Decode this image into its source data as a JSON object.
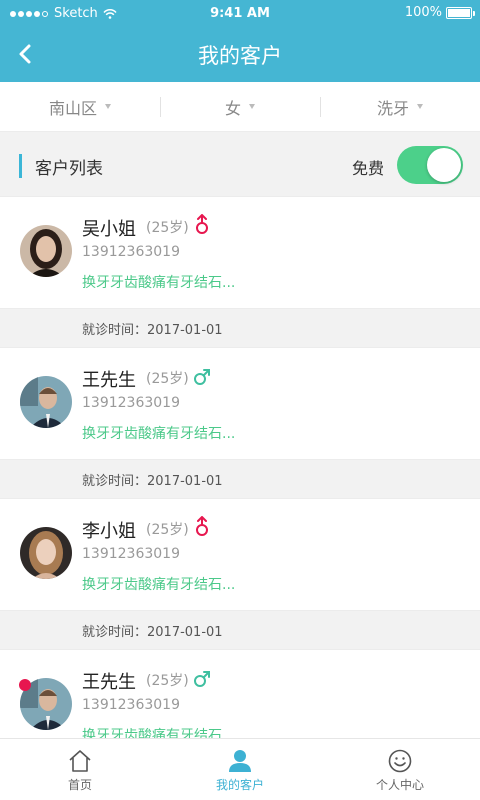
{
  "status_bar": {
    "carrier": "Sketch",
    "time": "9:41 AM",
    "battery": "100%"
  },
  "header": {
    "title": "我的客户",
    "back_icon": "chevron-left-icon"
  },
  "filters": [
    {
      "label": "南山区"
    },
    {
      "label": "女"
    },
    {
      "label": "洗牙"
    }
  ],
  "section": {
    "title": "客户列表",
    "toggle_label": "免费",
    "toggle_on": true
  },
  "customers": [
    {
      "name": "吴小姐",
      "age": "(25岁)",
      "gender": "female",
      "phone": "13912363019",
      "desc": "换牙牙齿酸痛有牙结石...",
      "visit": "就诊时间：2017-01-01"
    },
    {
      "name": "王先生",
      "age": "(25岁)",
      "gender": "male",
      "phone": "13912363019",
      "desc": "换牙牙齿酸痛有牙结石...",
      "visit": "就诊时间：2017-01-01"
    },
    {
      "name": "李小姐",
      "age": "(25岁)",
      "gender": "female",
      "phone": "13912363019",
      "desc": "换牙牙齿酸痛有牙结石...",
      "visit": "就诊时间：2017-01-01"
    },
    {
      "name": "王先生",
      "age": "(25岁)",
      "gender": "male",
      "phone": "13912363019",
      "desc": "换牙牙齿酸痛有牙结石..."
    }
  ],
  "tabs": [
    {
      "label": "首页",
      "icon": "home-icon"
    },
    {
      "label": "我的客户",
      "icon": "user-icon"
    },
    {
      "label": "个人中心",
      "icon": "smiley-icon"
    }
  ],
  "colors": {
    "primary": "#45b6d3",
    "accent_green": "#4cd08a",
    "female": "#e7174f",
    "male": "#3fbfa0"
  }
}
